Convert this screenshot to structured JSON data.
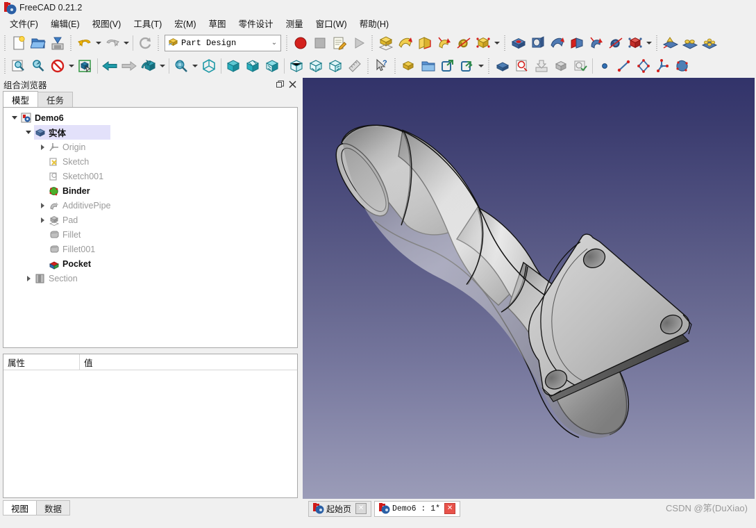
{
  "window": {
    "title": "FreeCAD 0.21.2",
    "app_icon": "freecad-logo-icon"
  },
  "menubar": {
    "items": [
      {
        "label": "文件(F)",
        "name": "menu-file"
      },
      {
        "label": "编辑(E)",
        "name": "menu-edit"
      },
      {
        "label": "视图(V)",
        "name": "menu-view"
      },
      {
        "label": "工具(T)",
        "name": "menu-tools"
      },
      {
        "label": "宏(M)",
        "name": "menu-macro"
      },
      {
        "label": "草图",
        "name": "menu-sketch"
      },
      {
        "label": "零件设计",
        "name": "menu-part-design"
      },
      {
        "label": "测量",
        "name": "menu-measure"
      },
      {
        "label": "窗口(W)",
        "name": "menu-window"
      },
      {
        "label": "帮助(H)",
        "name": "menu-help"
      }
    ]
  },
  "toolbar_top": {
    "file_group": [
      "new-document-icon",
      "open-document-icon",
      "save-document-icon"
    ],
    "edit_group": [
      "undo-icon",
      "undo-dropdown-icon",
      "redo-icon",
      "redo-dropdown-icon",
      "refresh-icon"
    ],
    "workbench": {
      "icon": "part-design-workbench-icon",
      "value": "Part Design",
      "chevron": "chevron-down-icon"
    },
    "macro_group": [
      "macro-record-icon",
      "macro-stop-icon",
      "macro-edit-icon",
      "macro-execute-icon"
    ],
    "partdesign_yellow_group": [
      "pad-icon",
      "revolution-icon",
      "additive-loft-icon",
      "additive-pipe-icon",
      "additive-helix-icon",
      "additive-primitive-icon",
      "additive-primitive-dropdown-icon"
    ],
    "partdesign_blue_group": [
      "pocket-icon",
      "hole-icon",
      "groove-icon",
      "subtractive-loft-icon",
      "subtractive-pipe-icon",
      "subtractive-helix-icon",
      "subtractive-primitive-icon",
      "subtractive-primitive-dropdown-icon"
    ],
    "transform_group": [
      "mirrored-icon",
      "linear-pattern-icon",
      "polar-pattern-icon"
    ]
  },
  "toolbar_second": {
    "view_group": [
      "fit-all-icon",
      "fit-selection-icon",
      "draw-style-icon",
      "draw-style-dropdown-icon",
      "selection-view-icon"
    ],
    "nav_group": [
      "previous-view-icon",
      "next-view-icon",
      "std-views-icon",
      "std-views-dropdown-icon"
    ],
    "zoom_group": [
      "zoom-box-icon",
      "zoom-dropdown-icon",
      "axonometric-icon"
    ],
    "std_views": [
      "front-view-icon",
      "top-view-icon",
      "right-view-icon",
      "rear-view-icon",
      "bottom-view-icon",
      "left-view-icon",
      "measure-icon"
    ],
    "help_group": [
      "whats-this-icon"
    ],
    "struct_group": [
      "create-part-icon",
      "create-group-icon",
      "link-icon",
      "link-group-icon",
      "link-group-dropdown-icon"
    ],
    "sketch_group": [
      "create-sketch-icon",
      "edit-sketch-icon",
      "attach-sketch-icon",
      "validate-sketch-icon",
      "map-sketch-icon"
    ],
    "geom_group": [
      "point-icon",
      "line-icon",
      "polyline-icon",
      "datum-icon",
      "shape-binder-icon"
    ]
  },
  "combo_view": {
    "title": "组合浏览器",
    "float_button": "restore-icon",
    "close_button": "close-icon",
    "tabs": [
      {
        "label": "模型",
        "name": "tab-model",
        "active": true
      },
      {
        "label": "任务",
        "name": "tab-tasks",
        "active": false
      }
    ]
  },
  "tree": {
    "items": [
      {
        "label": "Demo6",
        "indent": 0,
        "expander": "down",
        "icon": "document-icon",
        "bold": true,
        "selected": false
      },
      {
        "label": "实体",
        "indent": 1,
        "expander": "down",
        "icon": "body-icon",
        "bold": true,
        "selected": true
      },
      {
        "label": "Origin",
        "indent": 2,
        "expander": "right",
        "icon": "origin-icon",
        "bold": false,
        "selected": false
      },
      {
        "label": "Sketch",
        "indent": 2,
        "expander": "none",
        "icon": "sketch-icon",
        "bold": false,
        "selected": false
      },
      {
        "label": "Sketch001",
        "indent": 2,
        "expander": "none",
        "icon": "sketch001-icon",
        "bold": false,
        "selected": false
      },
      {
        "label": "Binder",
        "indent": 2,
        "expander": "none",
        "icon": "shape-binder-icon",
        "bold": true,
        "selected": false
      },
      {
        "label": "AdditivePipe",
        "indent": 2,
        "expander": "right",
        "icon": "additive-pipe-icon",
        "bold": false,
        "selected": false
      },
      {
        "label": "Pad",
        "indent": 2,
        "expander": "right",
        "icon": "pad-icon",
        "bold": false,
        "selected": false
      },
      {
        "label": "Fillet",
        "indent": 2,
        "expander": "none",
        "icon": "fillet-icon",
        "bold": false,
        "selected": false
      },
      {
        "label": "Fillet001",
        "indent": 2,
        "expander": "none",
        "icon": "fillet-icon",
        "bold": false,
        "selected": false
      },
      {
        "label": "Pocket",
        "indent": 2,
        "expander": "none",
        "icon": "pocket-icon",
        "bold": true,
        "selected": false
      },
      {
        "label": "Section",
        "indent": 1,
        "expander": "right",
        "icon": "section-icon",
        "bold": false,
        "selected": false
      }
    ]
  },
  "properties": {
    "columns": [
      "属性",
      "值"
    ],
    "rows": []
  },
  "property_tabs": [
    {
      "label": "视图",
      "name": "tab-view",
      "active": true
    },
    {
      "label": "数据",
      "name": "tab-data",
      "active": false
    }
  ],
  "document_tabs": [
    {
      "label": "起始页",
      "name": "doc-tab-start-page",
      "active": false,
      "mono": false,
      "close_red": false
    },
    {
      "label": "Demo6 : 1*",
      "name": "doc-tab-demo6",
      "active": true,
      "mono": true,
      "close_red": true
    }
  ],
  "viewport": {
    "background_top": "#32336a",
    "background_bottom": "#9b9cb8",
    "model_name": "exhaust-downpipe-3d-model",
    "model_fill_light": "#e6e6e6",
    "model_fill_mid": "#b8b8b8",
    "model_fill_dark": "#8a8a8a",
    "edge_color": "#1a1a1a"
  },
  "watermark": {
    "text": "CSDN @笫(DuXiao)"
  },
  "colors": {
    "chrome": "#f0f0f0",
    "panel_white": "#ffffff",
    "tree_selection": "#e3e1fa",
    "border": "#a8a8a8",
    "accent_red": "#d01a19",
    "accent_blue": "#2a5fa5",
    "yellow_feature": "#f2c33a",
    "blue_feature": "#2f6fb5"
  }
}
